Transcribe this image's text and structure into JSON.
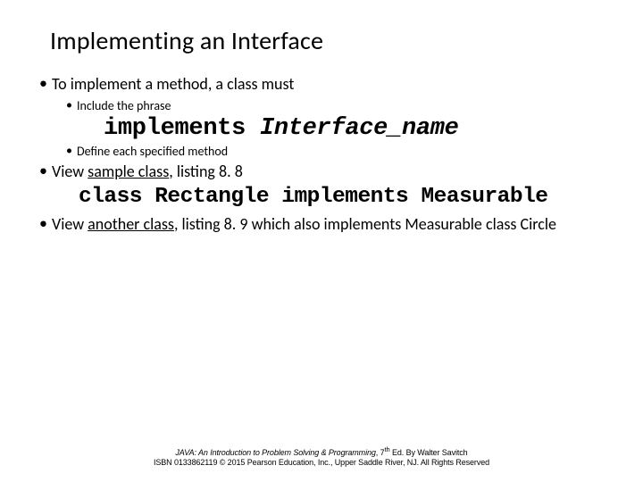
{
  "title": "Implementing an Interface",
  "bullets": {
    "b1": "To implement a method, a class must",
    "b1a": "Include the phrase",
    "code1_kw": "implements ",
    "code1_it": "Interface_name",
    "b1b": "Define each specified method",
    "b2_pre": "View ",
    "b2_link": "sample class",
    "b2_post": ", listing 8. 8",
    "code2": "class Rectangle implements Measurable",
    "b3_pre": "View ",
    "b3_link": "another class",
    "b3_post": ", listing 8. 9 which also implements Measurable class Circle"
  },
  "footer": {
    "line1a": "JAVA: An Introduction to Problem Solving & Programming",
    "line1b": ", 7",
    "line1c": "th",
    "line1d": " Ed. By Walter Savitch",
    "line2": "ISBN 0133862119 © 2015 Pearson Education, Inc., Upper Saddle River, NJ. All Rights Reserved"
  }
}
